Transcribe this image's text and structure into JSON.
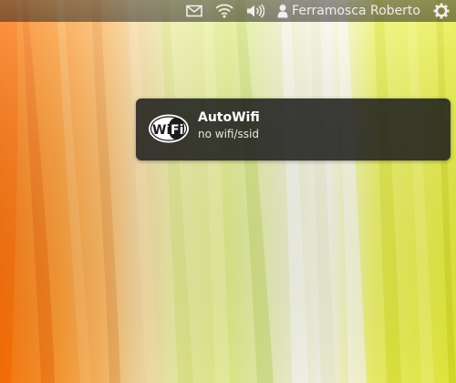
{
  "panel": {
    "indicators": [
      {
        "icon": "mail-icon"
      },
      {
        "icon": "wifi-icon"
      },
      {
        "icon": "volume-icon"
      },
      {
        "icon": "user-icon"
      },
      {
        "icon": "gear-icon"
      }
    ],
    "user_name": "Ferramosca Roberto"
  },
  "notification": {
    "icon": "wifi-logo-icon",
    "logo_text": "Wi Fi",
    "title": "AutoWifi",
    "body": "no wifi/ssid"
  },
  "colors": {
    "panel_text": "#eeeeec",
    "bubble_bg": "#1c1c1c",
    "title_text": "#ffffff",
    "body_text": "#e6e6e6"
  }
}
